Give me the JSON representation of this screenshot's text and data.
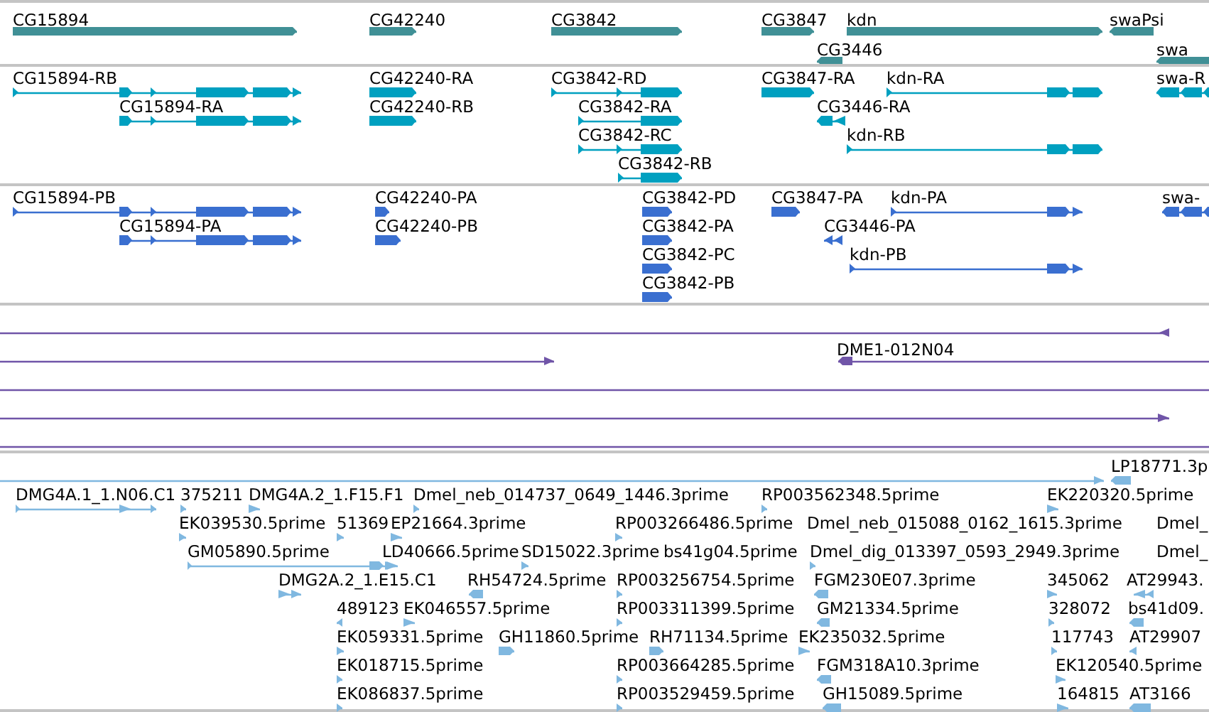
{
  "tracks": [
    {
      "kind": "gene",
      "color": "#409096",
      "features": [
        {
          "label": "CG15894",
          "reverse": false
        },
        {
          "label": "CG42240",
          "reverse": false
        },
        {
          "label": "CG3842",
          "reverse": false
        },
        {
          "label": "CG3847",
          "reverse": false
        },
        {
          "label": "kdn",
          "reverse": false
        },
        {
          "label": "swaPsi",
          "reverse": true
        },
        {
          "label": "CG3446",
          "reverse": true
        },
        {
          "label": "swa",
          "reverse": true
        }
      ]
    },
    {
      "kind": "transcript",
      "color": "#00a0c0",
      "features": [
        {
          "label": "CG15894-RB",
          "reverse": false
        },
        {
          "label": "CG15894-RA",
          "reverse": false
        },
        {
          "label": "CG42240-RA",
          "reverse": false
        },
        {
          "label": "CG42240-RB",
          "reverse": false
        },
        {
          "label": "CG3842-RD",
          "reverse": false
        },
        {
          "label": "CG3842-RA",
          "reverse": false
        },
        {
          "label": "CG3842-RC",
          "reverse": false
        },
        {
          "label": "CG3842-RB",
          "reverse": false
        },
        {
          "label": "CG3847-RA",
          "reverse": false
        },
        {
          "label": "CG3446-RA",
          "reverse": true
        },
        {
          "label": "kdn-RA",
          "reverse": false
        },
        {
          "label": "kdn-RB",
          "reverse": false
        },
        {
          "label": "swa-R",
          "reverse": true
        }
      ]
    },
    {
      "kind": "protein",
      "color": "#3a6fd0",
      "features": [
        {
          "label": "CG15894-PB",
          "reverse": false
        },
        {
          "label": "CG15894-PA",
          "reverse": false
        },
        {
          "label": "CG42240-PA",
          "reverse": false
        },
        {
          "label": "CG42240-PB",
          "reverse": false
        },
        {
          "label": "CG3842-PD",
          "reverse": false
        },
        {
          "label": "CG3842-PA",
          "reverse": false
        },
        {
          "label": "CG3842-PC",
          "reverse": false
        },
        {
          "label": "CG3842-PB",
          "reverse": false
        },
        {
          "label": "CG3847-PA",
          "reverse": false
        },
        {
          "label": "CG3446-PA",
          "reverse": true
        },
        {
          "label": "kdn-PA",
          "reverse": false
        },
        {
          "label": "kdn-PB",
          "reverse": false
        },
        {
          "label": "swa-",
          "reverse": true
        }
      ]
    },
    {
      "kind": "clone",
      "color": "#7055a8",
      "features": [
        {
          "kind": "arrow",
          "reverse": true
        },
        {
          "kind": "arrow",
          "reverse": false
        },
        {
          "kind": "arrow",
          "label": "DME1-012N04",
          "reverse": true
        },
        {
          "kind": "line"
        },
        {
          "kind": "arrow",
          "reverse": false
        },
        {
          "kind": "line"
        }
      ]
    },
    {
      "kind": "est",
      "color": "#80b8e0",
      "features": [
        {
          "reverse": false
        },
        {
          "label": "LP18771.3p",
          "reverse": true
        },
        {
          "label": "DMG4A.1_1.N06.C1",
          "reverse": false
        },
        {
          "label": "375211",
          "reverse": false
        },
        {
          "label": "DMG4A.2_1.F15.F1",
          "reverse": false
        },
        {
          "label": "Dmel_neb_014737_0649_1446.3prime",
          "reverse": false
        },
        {
          "label": "RP003562348.5prime",
          "reverse": false
        },
        {
          "label": "EK220320.5prime",
          "reverse": false
        },
        {
          "label": "EK039530.5prime",
          "reverse": false
        },
        {
          "label": "51369",
          "reverse": false
        },
        {
          "label": "EP21664.3prime",
          "reverse": false
        },
        {
          "label": "RP003266486.5prime",
          "reverse": false
        },
        {
          "label": "Dmel_neb_015088_0162_1615.3prime"
        },
        {
          "label": "Dmel_"
        },
        {
          "label": "GM05890.5prime",
          "reverse": false
        },
        {
          "label": "LD40666.5prime",
          "reverse": false
        },
        {
          "label": "SD15022.3prime",
          "reverse": false
        },
        {
          "label": "bs41g04.5prime"
        },
        {
          "label": "Dmel_dig_013397_0593_2949.3prime",
          "reverse": false
        },
        {
          "label": "Dmel_"
        },
        {
          "label": "DMG2A.2_1.E15.C1",
          "reverse": false
        },
        {
          "label": "RH54724.5prime",
          "reverse": true
        },
        {
          "label": "RP003256754.5prime",
          "reverse": false
        },
        {
          "label": "FGM230E07.3prime",
          "reverse": true
        },
        {
          "label": "345062",
          "reverse": false
        },
        {
          "label": "AT29943.",
          "reverse": true
        },
        {
          "label": "489123",
          "reverse": true
        },
        {
          "label": "EK046557.5prime",
          "reverse": false
        },
        {
          "label": "RP003311399.5prime",
          "reverse": false
        },
        {
          "label": "GM21334.5prime",
          "reverse": true
        },
        {
          "label": "328072",
          "reverse": false
        },
        {
          "label": "bs41d09.",
          "reverse": true
        },
        {
          "label": "EK059331.5prime",
          "reverse": false
        },
        {
          "label": "GH11860.5prime",
          "reverse": false
        },
        {
          "label": "RH71134.5prime",
          "reverse": false
        },
        {
          "label": "EK235032.5prime",
          "reverse": false
        },
        {
          "label": "117743",
          "reverse": false
        },
        {
          "label": "AT29907",
          "reverse": true
        },
        {
          "label": "EK018715.5prime",
          "reverse": false
        },
        {
          "label": "RP003664285.5prime",
          "reverse": false
        },
        {
          "label": "FGM318A10.3prime",
          "reverse": true
        },
        {
          "label": "EK120540.5prime",
          "reverse": false
        },
        {
          "label": "EK086837.5prime",
          "reverse": false
        },
        {
          "label": "RP003529459.5prime",
          "reverse": false
        },
        {
          "label": "GH15089.5prime",
          "reverse": true
        },
        {
          "label": "164815",
          "reverse": false
        },
        {
          "label": "AT3166",
          "reverse": true
        }
      ]
    }
  ]
}
